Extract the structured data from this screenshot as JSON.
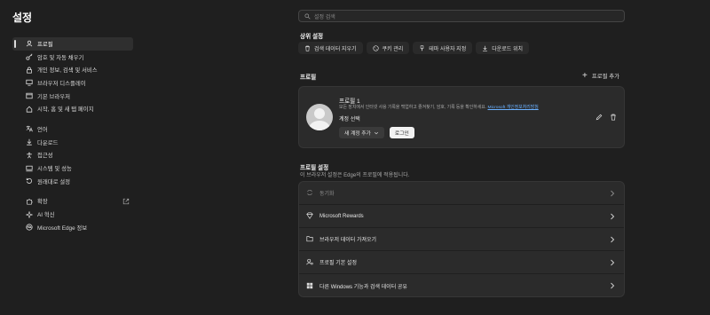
{
  "app": {
    "title": "설정"
  },
  "sidebar": {
    "items": [
      {
        "label": "프로필",
        "icon": "profile-icon",
        "active": true
      },
      {
        "label": "암호 및 자동 채우기",
        "icon": "key-icon"
      },
      {
        "label": "개인 정보, 검색 및 서비스",
        "icon": "lock-icon"
      },
      {
        "label": "브라우저 디스플레이",
        "icon": "display-icon"
      },
      {
        "label": "기본 브라우저",
        "icon": "browser-icon"
      },
      {
        "label": "시작, 홈 및 새 탭 페이지",
        "icon": "home-icon"
      },
      {
        "label": "언어",
        "icon": "language-icon"
      },
      {
        "label": "다운로드",
        "icon": "download-icon"
      },
      {
        "label": "접근성",
        "icon": "accessibility-icon"
      },
      {
        "label": "시스템 및 성능",
        "icon": "system-icon"
      },
      {
        "label": "원래대로 설정",
        "icon": "reset-icon"
      },
      {
        "label": "확장",
        "icon": "extension-icon"
      },
      {
        "label": "AI 혁신",
        "icon": "ai-icon"
      },
      {
        "label": "Microsoft Edge 정보",
        "icon": "edge-icon"
      }
    ]
  },
  "search": {
    "placeholder": "설정 검색"
  },
  "quick": {
    "title": "상위 설정",
    "chips": [
      {
        "label": "검색 데이터 지우기",
        "icon": "trash-icon"
      },
      {
        "label": "쿠키 관리",
        "icon": "cookie-icon"
      },
      {
        "label": "테마 사용자 지정",
        "icon": "brush-icon"
      },
      {
        "label": "다운로드 위치",
        "icon": "download-icon"
      }
    ]
  },
  "profiles": {
    "title": "프로필",
    "add_label": "프로필 추가",
    "card": {
      "name": "프로필 1",
      "description": "모든 장치에서 인터넷 사용 기록을 백업하고 즐겨찾기, 암호, 기록 등을 확인하세요.",
      "link": "Microsoft 개인정보처리방침",
      "account_label": "계정 선택",
      "new_account_label": "새 계정 추가",
      "login_label": "로그인"
    }
  },
  "profile_settings": {
    "title": "프로필 설정",
    "subtitle": "이 브라우저 설정은 Edge의 프로필에 적용됩니다.",
    "rows": [
      {
        "label": "동기화",
        "icon": "sync-icon"
      },
      {
        "label": "Microsoft Rewards",
        "icon": "rewards-icon"
      },
      {
        "label": "브라우저 데이터 가져오기",
        "icon": "import-icon"
      },
      {
        "label": "프로필 기본 설정",
        "icon": "profile-settings-icon"
      },
      {
        "label": "다른 Windows 기능과 검색 데이터 공유",
        "icon": "windows-icon"
      }
    ]
  }
}
